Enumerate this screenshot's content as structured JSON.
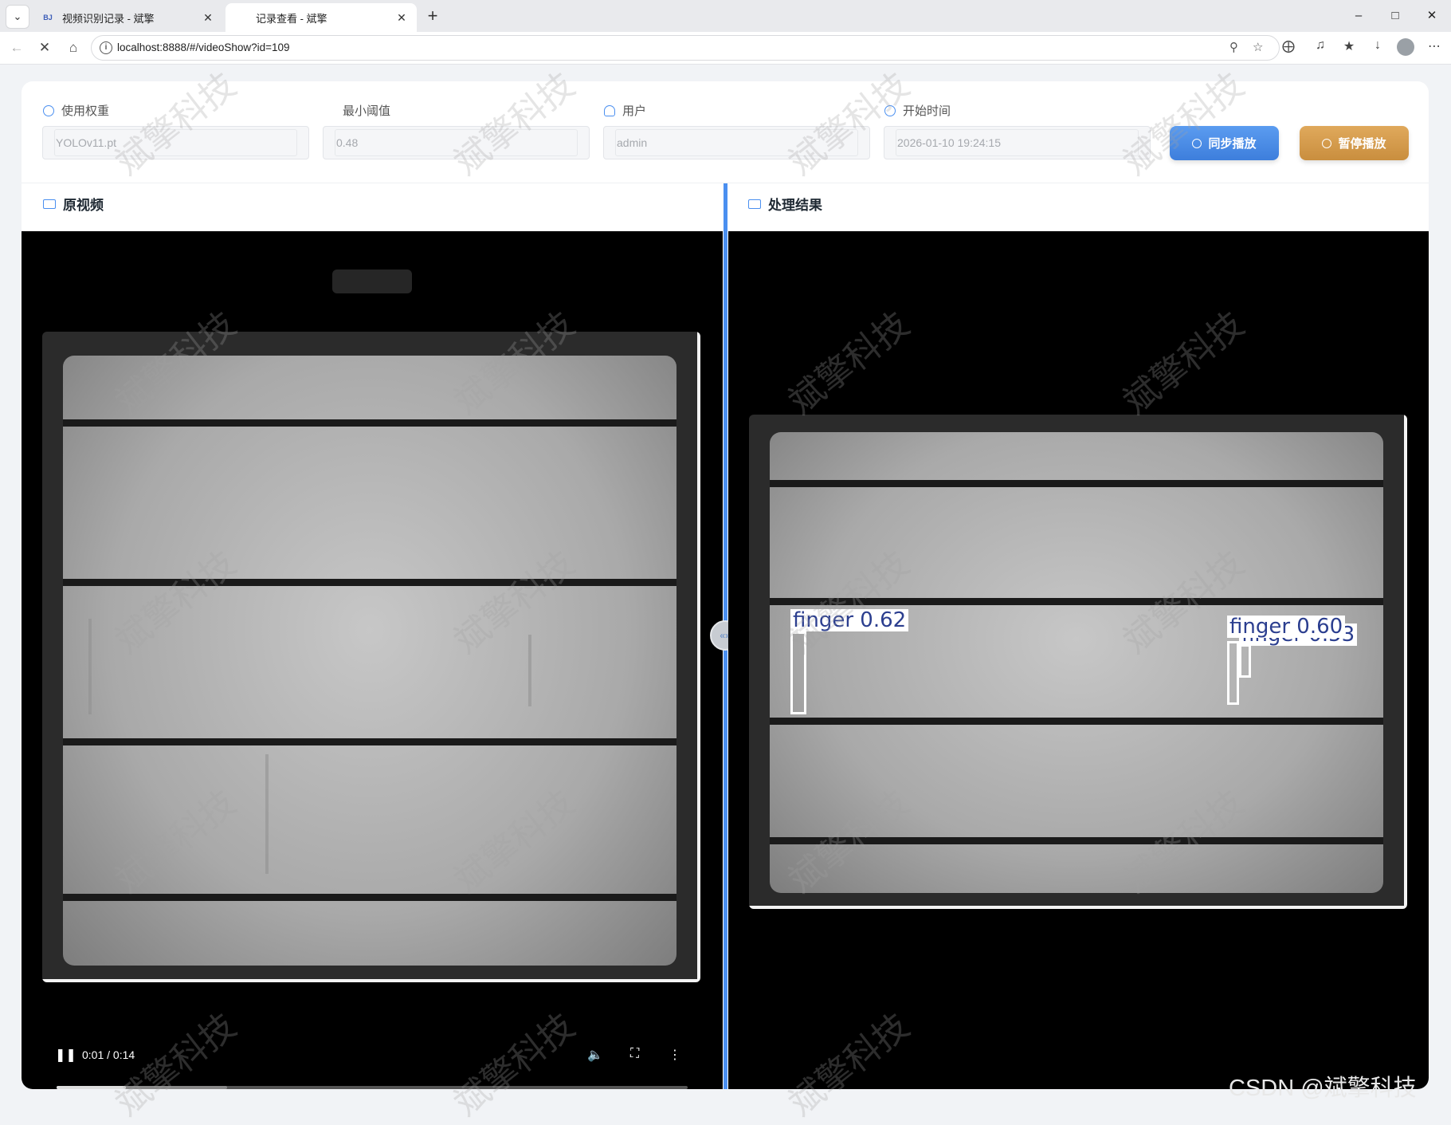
{
  "browser": {
    "tabs": [
      {
        "label": "视频识别记录 - 斌擎",
        "favicon": "BJ"
      },
      {
        "label": "记录查看 - 斌擎"
      }
    ],
    "url": "localhost:8888/#/videoShow?id=109"
  },
  "filters": {
    "weight": {
      "label": "使用权重",
      "value": "YOLOv11.pt"
    },
    "threshold": {
      "label": "最小阈值",
      "value": "0.48"
    },
    "user": {
      "label": "用户",
      "value": "admin"
    },
    "start_time": {
      "label": "开始时间",
      "value": "2026-01-10 19:24:15"
    }
  },
  "buttons": {
    "sync_label": "同步播放",
    "pause_label": "暂停播放"
  },
  "panels": {
    "original_title": "原视频",
    "result_title": "处理结果"
  },
  "video": {
    "time": "0:01 / 0:14",
    "played_fraction": 0.11,
    "buffered_fraction": 0.27
  },
  "detections": [
    {
      "label": "finger 0.62"
    },
    {
      "label": "finger 0.60"
    },
    {
      "label": "finger 0.53"
    }
  ],
  "watermark": "斌擎科技",
  "credit": "CSDN @斌擎科技",
  "colors": {
    "accent": "#4a8ff0",
    "sync_button": "#4a8ae6",
    "pause_button": "#d49d4d"
  }
}
